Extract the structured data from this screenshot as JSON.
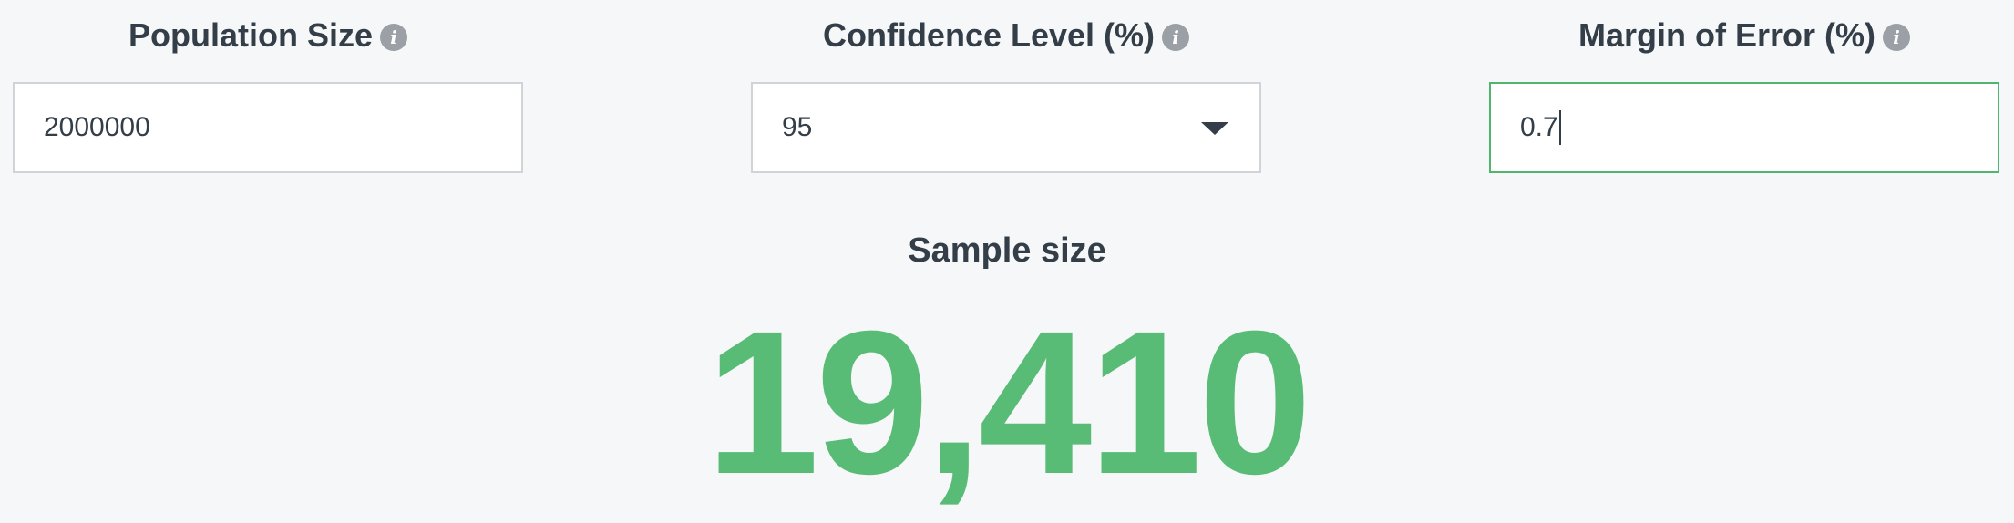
{
  "fields": {
    "population": {
      "label": "Population Size",
      "value": "2000000"
    },
    "confidence": {
      "label": "Confidence Level (%)",
      "value": "95"
    },
    "margin": {
      "label": "Margin of Error (%)",
      "value": "0.7"
    }
  },
  "result": {
    "label": "Sample size",
    "value": "19,410"
  },
  "icons": {
    "info": "info-icon",
    "dropdown": "chevron-down-icon"
  },
  "colors": {
    "accent": "#58bc76",
    "focus_border": "#4fb56f",
    "text": "#333e48",
    "info_icon": "#9aa0a5"
  }
}
